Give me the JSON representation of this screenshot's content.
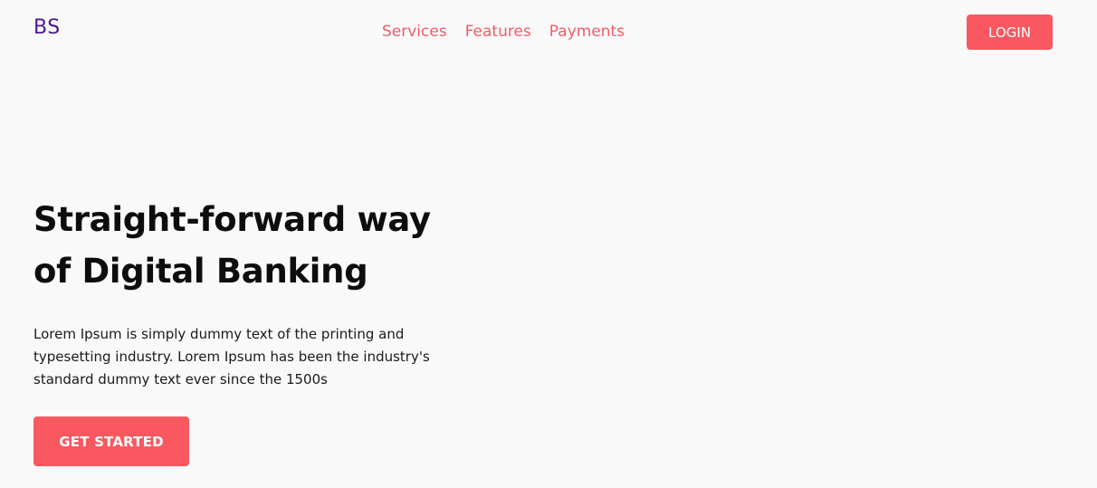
{
  "brand": {
    "logo_text": "BS"
  },
  "nav": {
    "items": [
      {
        "label": "Services"
      },
      {
        "label": "Features"
      },
      {
        "label": "Payments"
      }
    ]
  },
  "header": {
    "login_label": "LOGIN"
  },
  "hero": {
    "title_line1": "Straight-forward way",
    "title_line2": "of Digital Banking",
    "description": "Lorem Ipsum is simply dummy text of the printing and typesetting industry. Lorem Ipsum has been the industry's standard dummy text ever since the 1500s",
    "cta_label": "GET STARTED"
  },
  "colors": {
    "background": "#f9f9fa",
    "brand": "#4b1a8e",
    "accent": "#f95860",
    "nav_link": "#f25c65",
    "heading": "#0d0d0d"
  }
}
